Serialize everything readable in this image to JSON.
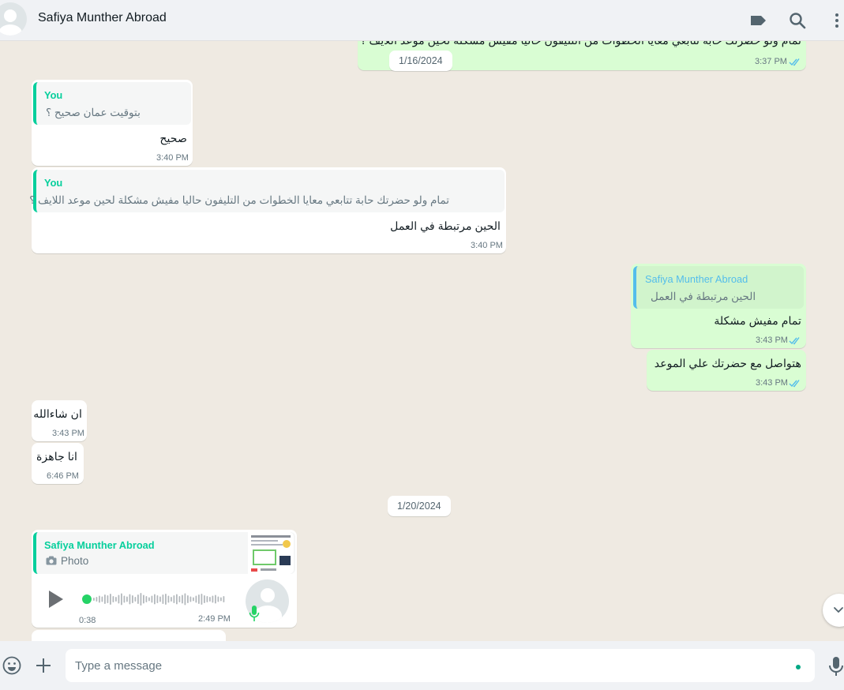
{
  "header": {
    "contact_name": "Safiya Munther Abroad",
    "icons": [
      "label-icon",
      "search-icon",
      "menu-icon"
    ]
  },
  "messages": {
    "top_cut": {
      "text": "تمام ولو حضرتك حابة تتابعي معايا الخطوات من التليفون حاليا مفيش مشكلة لحين موعد اللايف ؟",
      "time": "3:37 PM"
    },
    "date_1": "1/16/2024",
    "m1": {
      "quote_author": "You",
      "quote_text": "بتوقيت عمان صحيح ؟",
      "text": "صحيح",
      "time": "3:40 PM"
    },
    "m2": {
      "quote_author": "You",
      "quote_text": "تمام ولو حضرتك حابة تتابعي معايا الخطوات من التليفون حاليا مفيش مشكلة لحين موعد اللايف ؟",
      "text": "الحين مرتبطة في العمل",
      "time": "3:40 PM"
    },
    "m3": {
      "quote_author": "Safiya Munther Abroad",
      "quote_text": "الحين مرتبطة في العمل",
      "text": "تمام مفيش مشكلة",
      "time": "3:43 PM"
    },
    "m4": {
      "text": "هتواصل مع حضرتك علي الموعد",
      "time": "3:43 PM"
    },
    "m5": {
      "text": "ان شاءالله",
      "time": "3:43 PM"
    },
    "m6": {
      "text": "انا جاهزة",
      "time": "6:46 PM"
    },
    "date_2": "1/20/2024",
    "voice": {
      "quote_author": "Safiya Munther Abroad",
      "quote_label": "Photo",
      "duration": "0:38",
      "time": "2:49 PM",
      "progress": 0
    }
  },
  "composer": {
    "placeholder": "Type a message"
  },
  "colors": {
    "outgoing": "#d9fdd3",
    "incoming": "#ffffff",
    "accent": "#06cf9c",
    "read_ticks": "#53bdeb"
  }
}
